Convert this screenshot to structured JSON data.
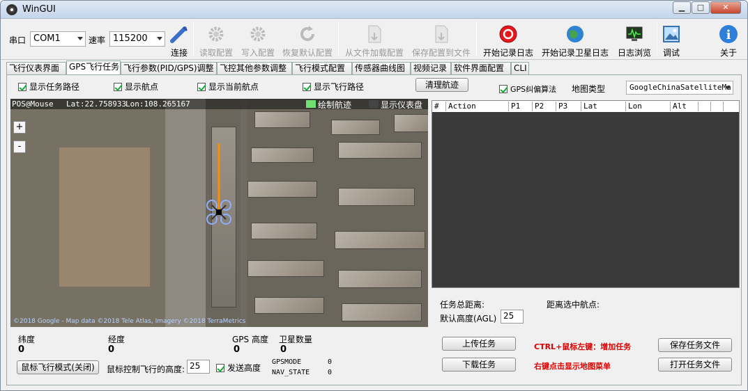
{
  "window": {
    "title": "WinGUI",
    "minimize": "▁",
    "maximize": "□",
    "close": "✕"
  },
  "toolbar": {
    "port_label": "串口",
    "port_value": "COM1",
    "baud_label": "速率",
    "baud_value": "115200",
    "connect": "连接",
    "read_config": "读取配置",
    "write_config": "写入配置",
    "restore_default": "恢复默认配置",
    "load_from_file": "从文件加载配置",
    "save_to_file": "保存配置到文件",
    "start_log": "开始记录日志",
    "start_sat_log": "开始记录卫星日志",
    "log_browse": "日志浏览",
    "debug": "调试",
    "about": "关于"
  },
  "tabs": [
    "飞行仪表界面",
    "GPS飞行任务",
    "飞行参数(PID/GPS)调整",
    "飞控其他参数调整",
    "飞行模式配置",
    "传感器曲线图",
    "视频记录",
    "软件界面配置",
    "CLI"
  ],
  "options": {
    "show_mission_path": "显示任务路径",
    "show_waypoints": "显示航点",
    "show_current_wp": "显示当前航点",
    "show_flight_path": "显示飞行路径",
    "clear_track": "清理航迹",
    "gps_correction": "GPS纠偏算法",
    "map_type_label": "地图类型",
    "map_type_value": "GoogleChinaSatelliteMa"
  },
  "map": {
    "pos_label": "POS@Mouse",
    "lat": "Lat:22.758933",
    "lon": "Lon:108.265167",
    "draw_track": "绘制航迹",
    "show_instruments": "显示仪表盘",
    "zoom_in": "+",
    "zoom_out": "-",
    "copyright": "©2018 Google - Map data ©2018 Tele Atlas, Imagery ©2018 TerraMetrics"
  },
  "grid": {
    "columns": [
      "#",
      "Action",
      "P1",
      "P2",
      "P3",
      "Lat",
      "Lon",
      "Alt"
    ]
  },
  "status": {
    "lat_label": "纬度",
    "lat_value": "0",
    "lon_label": "经度",
    "lon_value": "0",
    "gps_alt_label": "GPS 高度",
    "gps_alt_value": "0",
    "sat_label": "卫星数量",
    "sat_value": "0",
    "mouse_mode_btn": "鼠标飞行模式(关闭)",
    "mouse_alt_label": "鼠标控制飞行的高度:",
    "mouse_alt_value": "25",
    "send_alt": "发送高度",
    "gpsmode_label": "GPSMODE",
    "gpsmode_value": "0",
    "navstate_label": "NAV_STATE",
    "navstate_value": "0"
  },
  "mission": {
    "total_dist_label": "任务总距离:",
    "dist_to_wp_label": "距离选中航点:",
    "default_alt_label": "默认高度(AGL)",
    "default_alt_value": "25",
    "upload": "上传任务",
    "download": "下载任务",
    "hint1": "CTRL+鼠标左键：增加任务",
    "hint2": "右键点击显示地图菜单",
    "save_file": "保存任务文件",
    "open_file": "打开任务文件"
  },
  "colors": {
    "accent_green": "#6fe06f",
    "track_orange": "#ff8c00",
    "hint_red": "#dd0000"
  }
}
